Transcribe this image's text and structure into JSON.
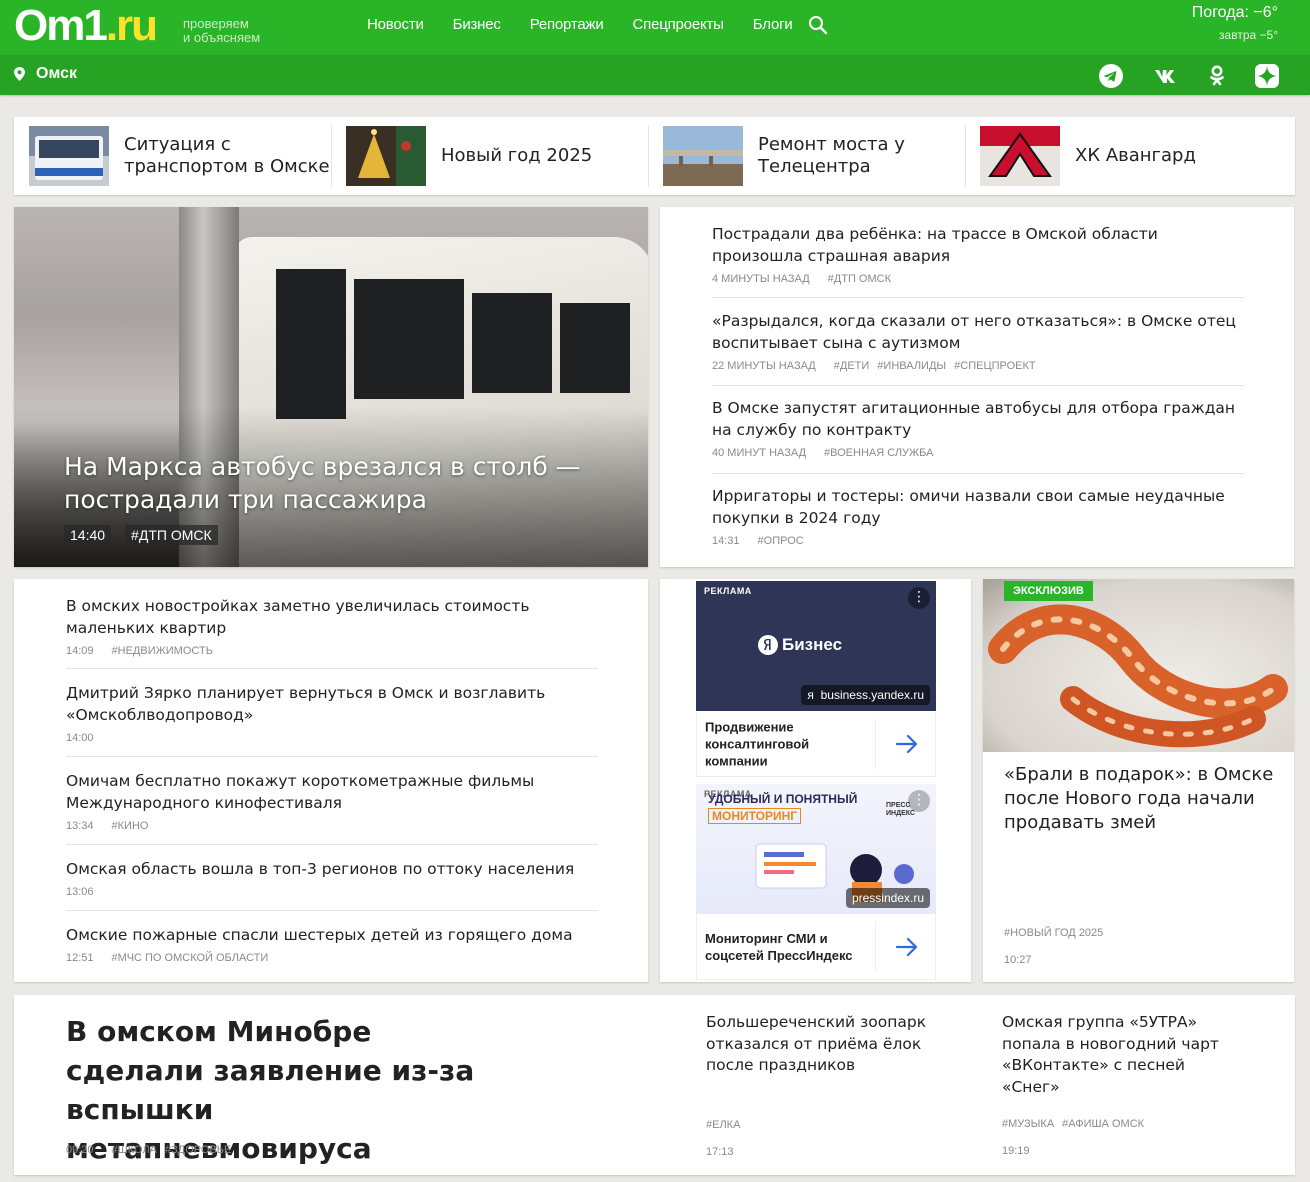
{
  "header": {
    "logo_main": "Om1",
    "logo_dot": ".ru",
    "slogan_line1": "проверяем",
    "slogan_line2": "и объясняем",
    "nav": [
      "Новости",
      "Бизнес",
      "Репортажи",
      "Спецпроекты",
      "Блоги"
    ],
    "weather_now": "Погода: −6°",
    "weather_tomorrow": "завтра  −5°",
    "city": "Омск",
    "brand_color": "#2ab528"
  },
  "trends": [
    {
      "title": "Ситуация с транспортом в Омске",
      "icon": "bus-photo"
    },
    {
      "title": "Новый год 2025",
      "icon": "christmas-tree-photo"
    },
    {
      "title": "Ремонт моста у Телецентра",
      "icon": "bridge-photo"
    },
    {
      "title": "ХК Авангард",
      "icon": "hockey-logo"
    }
  ],
  "hero": {
    "title": "На Маркса автобус врезался в столб — пострадали три пассажира",
    "time": "14:40",
    "tag": "#ДТП ОМСК"
  },
  "latest": [
    {
      "title": "Пострадали два ребёнка: на трассе в Омской области произошла страшная авария",
      "time": "4 минуты назад",
      "tags": [
        "#ДТП ОМСК"
      ]
    },
    {
      "title": "«Разрыдался, когда сказали от него отказаться»: в Омске отец воспитывает сына с аутизмом",
      "time": "22 минуты назад",
      "tags": [
        "#ДЕТИ",
        "#ИНВАЛИДЫ",
        "#СПЕЦПРОЕКТ"
      ]
    },
    {
      "title": "В Омске запустят агитационные автобусы для отбора граждан на службу по контракту",
      "time": "40 минут назад",
      "tags": [
        "#ВОЕННАЯ СЛУЖБА"
      ]
    },
    {
      "title": "Ирригаторы и тостеры: омичи назвали свои самые неудачные покупки в 2024 году",
      "time": "14:31",
      "tags": [
        "#ОПРОС"
      ]
    }
  ],
  "list2": [
    {
      "title": "В омских новостройках заметно увеличилась стоимость маленьких квартир",
      "time": "14:09",
      "tags": [
        "#НЕДВИЖИМОСТЬ"
      ]
    },
    {
      "title": "Дмитрий Зярко планирует вернуться в Омск и возглавить «Омскоблводопровод»",
      "time": "14:00",
      "tags": []
    },
    {
      "title": "Омичам бесплатно покажут короткометражные фильмы Международного кинофестиваля",
      "time": "13:34",
      "tags": [
        "#КИНО"
      ]
    },
    {
      "title": "Омская область вошла в топ-3 регионов по оттоку населения",
      "time": "13:06",
      "tags": []
    },
    {
      "title": "Омские пожарные спасли шестерых детей из горящего дома",
      "time": "12:51",
      "tags": [
        "#МЧС ПО ОМСКОЙ ОБЛАСТИ"
      ]
    }
  ],
  "ads": [
    {
      "label": "РЕКЛАМА",
      "brand": "Бизнес",
      "url": "business.yandex.ru",
      "text": "Продвижение консалтинговой компании"
    },
    {
      "label": "РЕКЛАМА",
      "headline1": "УДОБНЫЙ И ПОНЯТНЫЙ",
      "headline2": "МОНИТОРИНГ",
      "brand": "ПРЕСС ИНДЕКС",
      "url": "pressindex.ru",
      "text": "Мониторинг СМИ и соцсетей ПрессИндекс"
    }
  ],
  "exclusive": {
    "badge": "ЭКСКЛЮЗИВ",
    "title": "«Брали в подарок»: в Омске после Нового года начали продавать змей",
    "tag": "#НОВЫЙ ГОД 2025",
    "time": "10:27"
  },
  "bottom": {
    "main": {
      "title": "В омском Минобре сделали заявление из-за вспышки метапневмовируса",
      "time": "09:20",
      "tags": [
        "#ШКОЛА",
        "#ЗДОРОВЬЕ"
      ]
    },
    "col1": {
      "title": "Большереченский зоопарк отказался от приёма ёлок после праздников",
      "tag": "#ЕЛКА",
      "time": "17:13"
    },
    "col2": {
      "title": "Омская группа «5УТРА» попала в новогодний чарт «ВКонтакте» с песней «Снег»",
      "tags": [
        "#МУЗЫКА",
        "#АФИША ОМСК"
      ],
      "time": "19:19"
    }
  }
}
